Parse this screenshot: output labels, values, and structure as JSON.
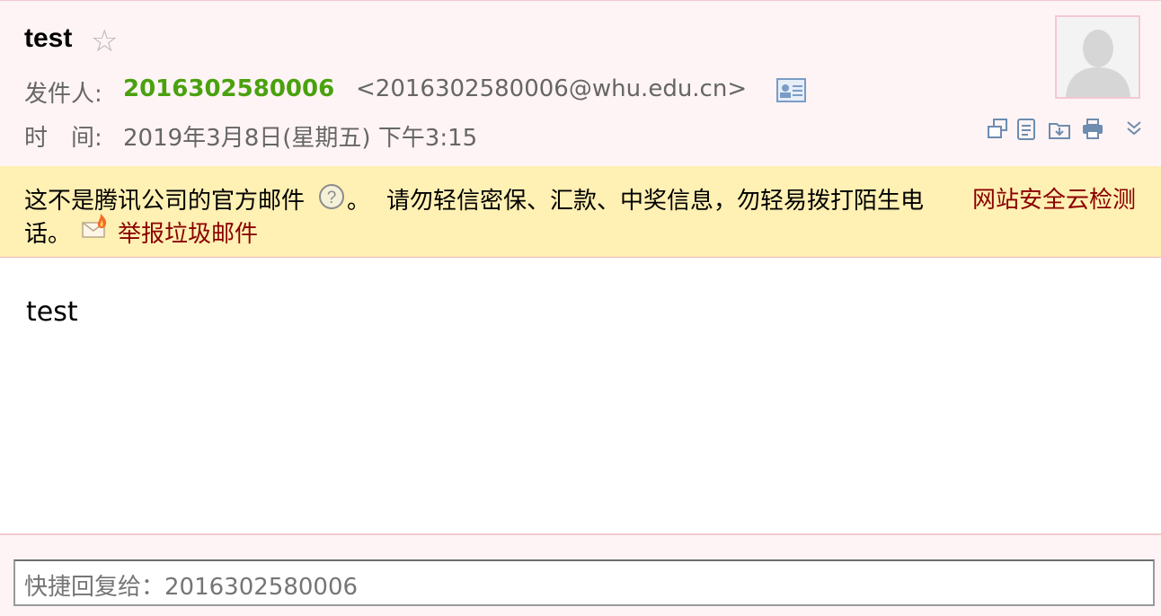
{
  "mail": {
    "subject": "test",
    "sender_label": "发件人:",
    "sender_name": "2016302580006",
    "sender_address": "<2016302580006@whu.edu.cn>",
    "time_label": "时　间:",
    "time_value": "2019年3月8日(星期五) 下午3:15",
    "body": "test"
  },
  "warning": {
    "part1": "这不是腾讯公司的官方邮件",
    "part1_suffix": "。",
    "part2": "请勿轻信密保、汇款、中奖信息，勿轻易拨打陌生电",
    "part3": "话。",
    "cloud_check": "网站安全云检测",
    "report_spam": "举报垃圾邮件"
  },
  "reply": {
    "placeholder": "快捷回复给：2016302580006"
  },
  "icons": {
    "star": "star-outline-icon",
    "contact_card": "contact-card-icon",
    "toolbar": [
      "new-window-icon",
      "view-source-icon",
      "save-download-icon",
      "print-icon",
      "expand-more-icon"
    ],
    "help": "question-circle-icon",
    "report": "spam-report-icon"
  },
  "colors": {
    "sender_name": "#4aa10e",
    "link_red": "#8b0000",
    "warning_bg": "#fff0b3",
    "header_bg": "#fff4f5"
  }
}
